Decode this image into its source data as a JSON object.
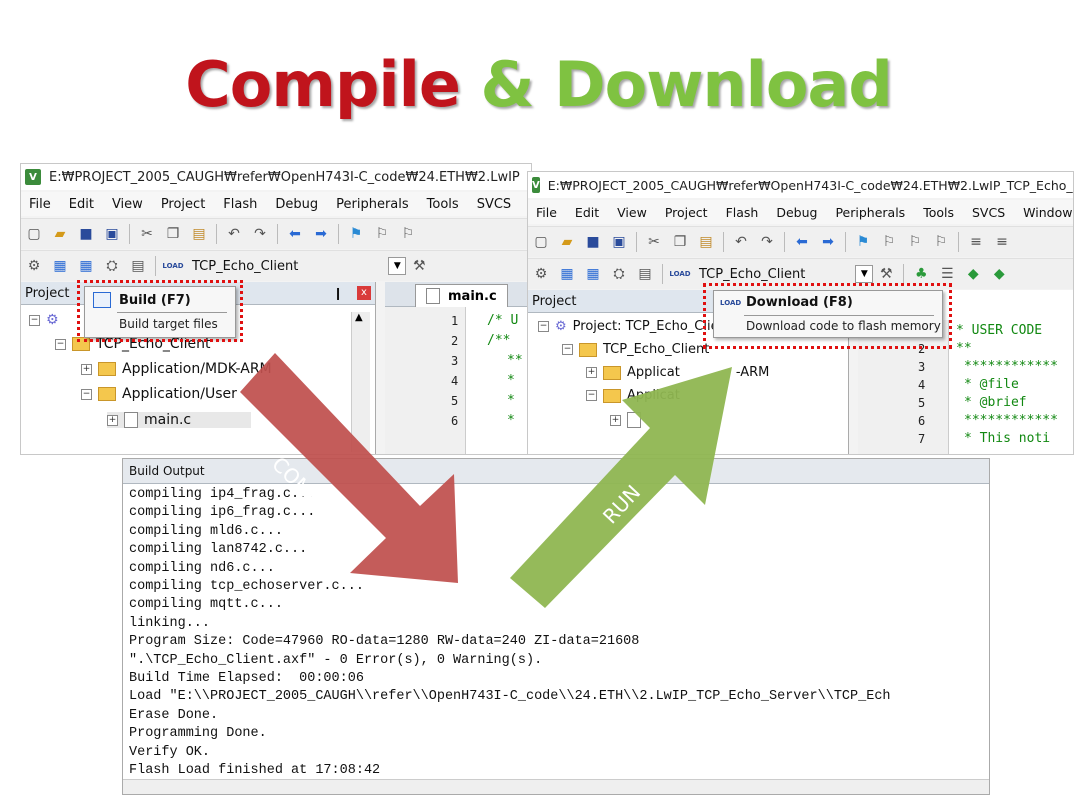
{
  "title": {
    "word1": "Compile",
    "word2": "& Download"
  },
  "colors": {
    "red_title": "#c0141c",
    "green_title": "#7fc241",
    "compile_arrow": "#c0504d",
    "run_arrow": "#8fb651",
    "highlight": "#e01010"
  },
  "left_window": {
    "title": "E:₩PROJECT_2005_CAUGH₩refer₩OpenH743I-C_code₩24.ETH₩2.LwIP",
    "menu": [
      "File",
      "Edit",
      "View",
      "Project",
      "Flash",
      "Debug",
      "Peripherals",
      "Tools",
      "SVCS"
    ],
    "target": "TCP_Echo_Client",
    "panel_title": "Project",
    "tree": [
      "TCP_Echo_Client",
      "Application/MDK-ARM",
      "Application/User",
      "main.c"
    ],
    "tab": "main.c",
    "line_numbers": [
      "1",
      "2",
      "3",
      "4",
      "5",
      "6"
    ],
    "code": [
      "/* U",
      "/**",
      "**",
      "*",
      "*",
      "*"
    ],
    "tooltip": {
      "title": "Build (F7)",
      "desc": "Build target files"
    }
  },
  "right_window": {
    "title": "E:₩PROJECT_2005_CAUGH₩refer₩OpenH743I-C_code₩24.ETH₩2.LwIP_TCP_Echo_S",
    "menu": [
      "File",
      "Edit",
      "View",
      "Project",
      "Flash",
      "Debug",
      "Peripherals",
      "Tools",
      "SVCS",
      "Window"
    ],
    "target": "TCP_Echo_Client",
    "panel_title": "Project",
    "tree": [
      "Project: TCP_Echo_Clie",
      "TCP_Echo_Client",
      "Applicat",
      "Applicat"
    ],
    "tree_suffix": "-ARM",
    "line_numbers": [
      "2",
      "3",
      "4",
      "5",
      "6",
      "7"
    ],
    "code": [
      "* USER CODE",
      "**",
      "************",
      "* @file",
      "* @brief",
      "************",
      "* This noti"
    ],
    "tooltip": {
      "title": "Download (F8)",
      "desc": "Download code to flash memory"
    }
  },
  "build_output": {
    "title": "Build Output",
    "lines": [
      "compiling ip4_frag.c...",
      "compiling ip6_frag.c...",
      "compiling mld6.c...",
      "compiling lan8742.c...",
      "compiling nd6.c...",
      "compiling tcp_echoserver.c...",
      "compiling mqtt.c...",
      "linking...",
      "Program Size: Code=47960 RO-data=1280 RW-data=240 ZI-data=21608",
      "\".\\TCP_Echo_Client.axf\" - 0 Error(s), 0 Warning(s).",
      "Build Time Elapsed:  00:00:06",
      "Load \"E:\\\\PROJECT_2005_CAUGH\\\\refer\\\\OpenH743I-C_code\\\\24.ETH\\\\2.LwIP_TCP_Echo_Server\\\\TCP_Ech",
      "Erase Done.",
      "Programming Done.",
      "Verify OK.",
      "Flash Load finished at 17:08:42"
    ]
  },
  "arrows": {
    "compile_label": "COMPILE",
    "run_label": "RUN"
  },
  "icons": {
    "load_label": "LOAD",
    "app_icon_label": "V",
    "pin_glyph": "❙",
    "close_glyph": "x"
  }
}
